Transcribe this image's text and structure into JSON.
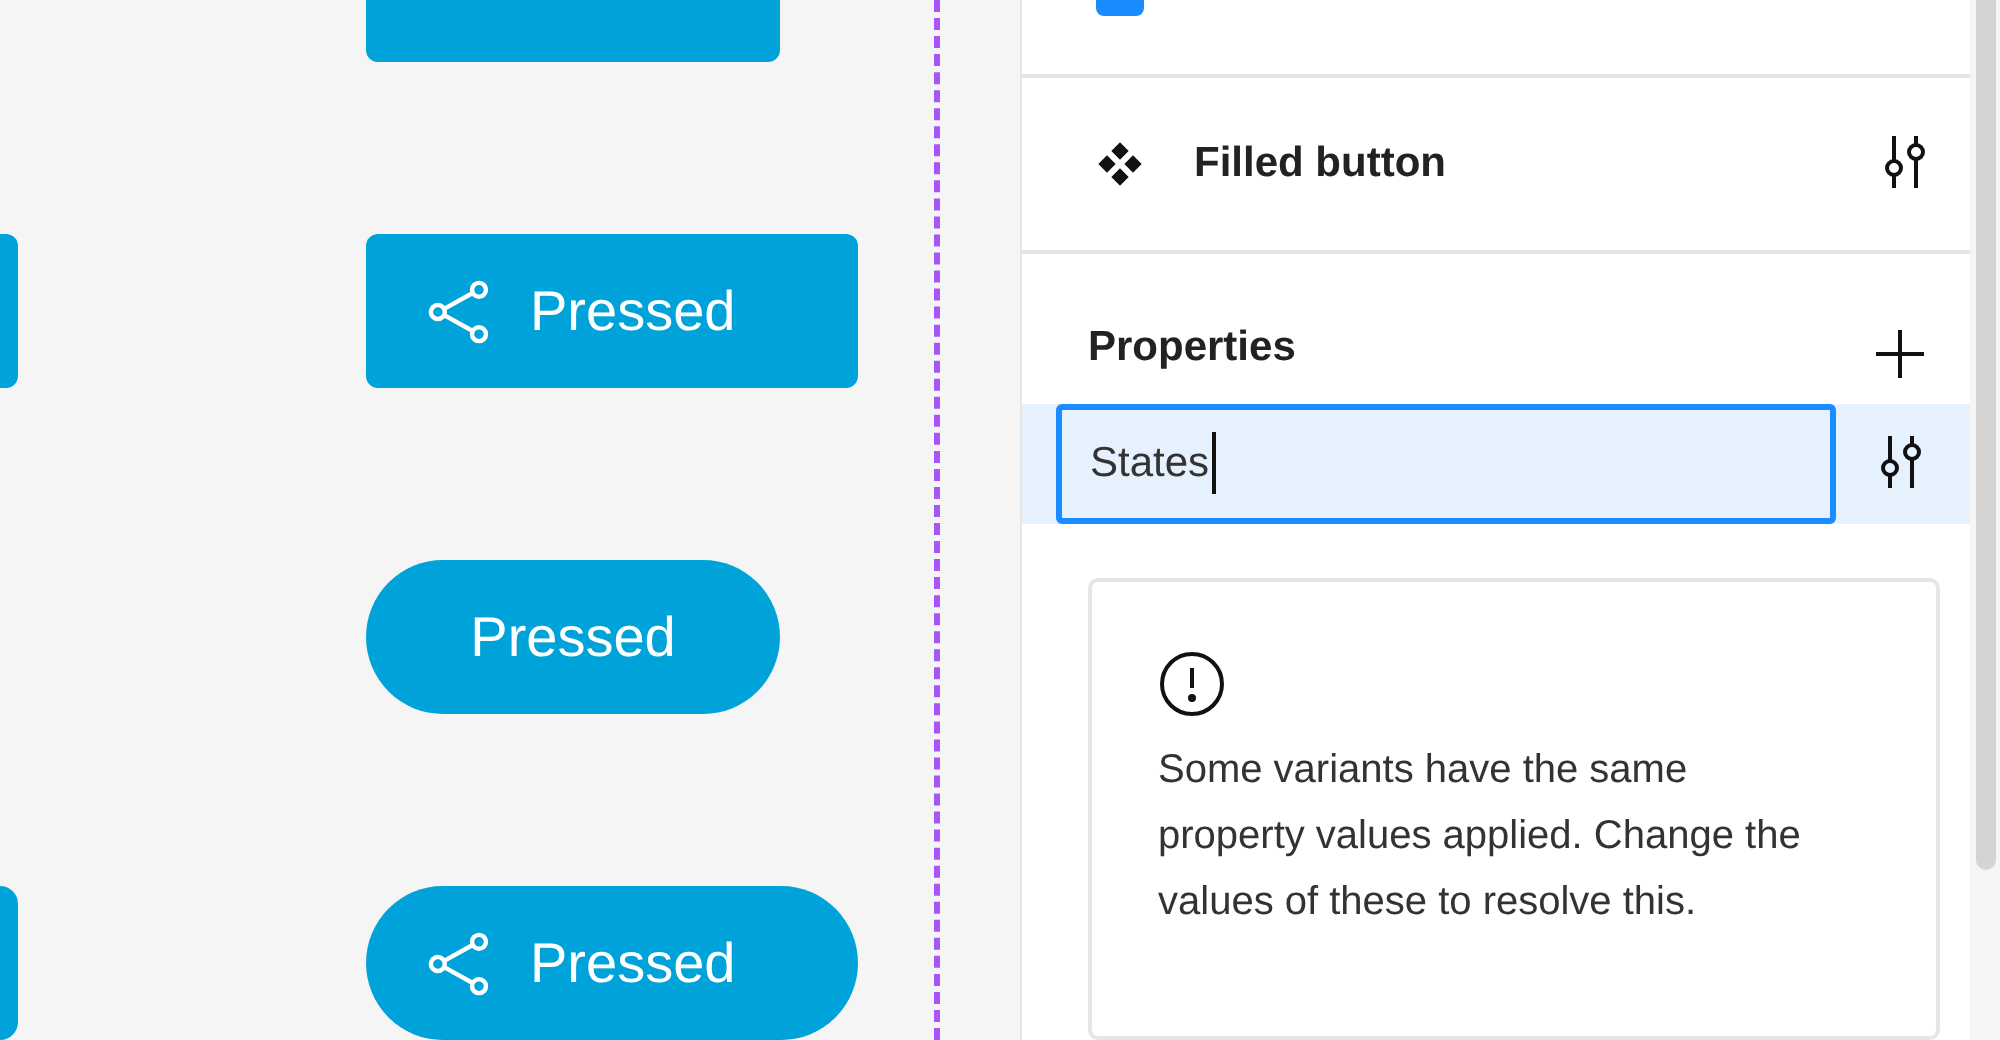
{
  "canvas": {
    "edge_buttons": [
      {
        "kind": "rect"
      },
      {
        "kind": "pill"
      }
    ],
    "top_button": {
      "kind": "rect"
    },
    "buttons": [
      {
        "label": "Pressed",
        "kind": "rect",
        "share_icon": true
      },
      {
        "label": "Pressed",
        "kind": "pill",
        "share_icon": false
      },
      {
        "label": "Pressed",
        "kind": "pill",
        "share_icon": true
      }
    ]
  },
  "panel": {
    "clip_content": {
      "checked": true
    },
    "component": {
      "name": "Filled button"
    },
    "properties": {
      "title": "Properties",
      "items": [
        {
          "value": "States",
          "selected": true
        }
      ]
    },
    "warning": {
      "text": "Some variants have the same property values applied. Change the values of these to resolve this."
    }
  }
}
